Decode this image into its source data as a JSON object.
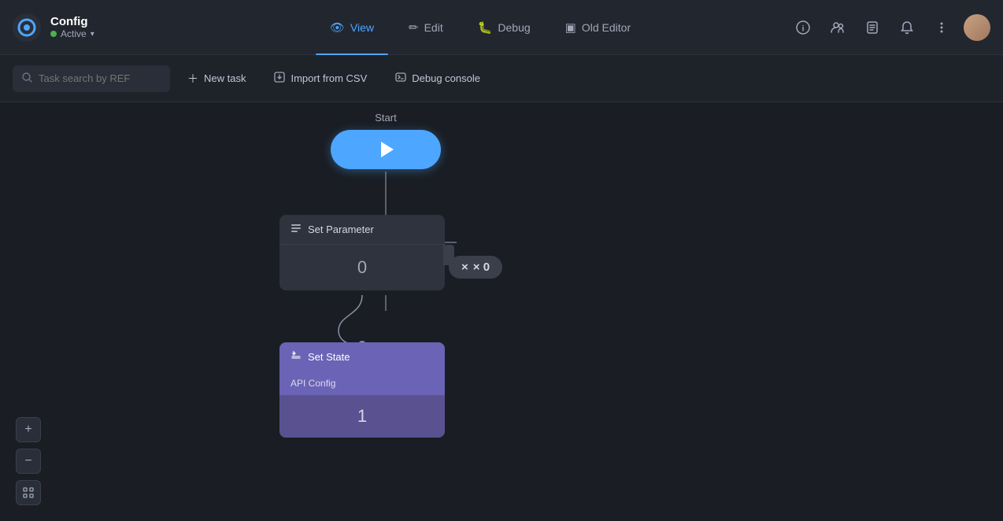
{
  "app": {
    "logo_text": "Config",
    "status": "Active",
    "status_color": "#4caf50"
  },
  "nav": {
    "tabs": [
      {
        "id": "view",
        "label": "View",
        "active": true
      },
      {
        "id": "edit",
        "label": "Edit",
        "active": false
      },
      {
        "id": "debug",
        "label": "Debug",
        "active": false
      },
      {
        "id": "old-editor",
        "label": "Old Editor",
        "active": false
      }
    ],
    "icons": [
      "info-icon",
      "users-icon",
      "document-icon",
      "bell-icon",
      "more-icon"
    ]
  },
  "toolbar": {
    "search_placeholder": "Task search by REF",
    "new_task_label": "New task",
    "import_label": "Import from CSV",
    "debug_console_label": "Debug console"
  },
  "canvas": {
    "start_label": "Start",
    "start_value": "",
    "set_param": {
      "label": "Set Parameter",
      "value": "0"
    },
    "x0_badge": "× 0",
    "set_state": {
      "label": "Set State",
      "subtitle": "API Config",
      "value": "1"
    }
  },
  "controls": {
    "zoom_in": "+",
    "zoom_out": "−",
    "fit": "⤢"
  }
}
